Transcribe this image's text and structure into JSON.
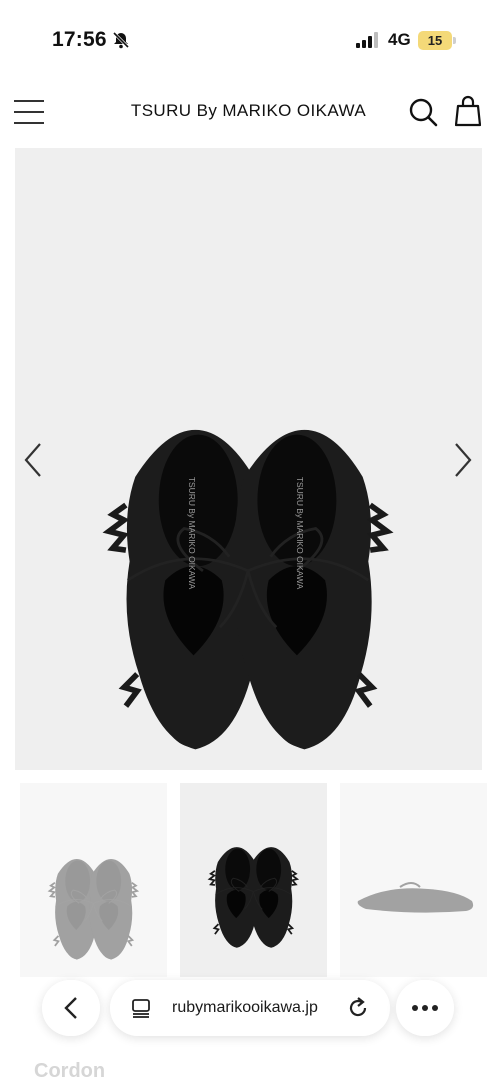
{
  "status_bar": {
    "time": "17:56",
    "network": "4G",
    "battery": "15",
    "icons": [
      "bell-muted-icon",
      "signal-icon"
    ]
  },
  "header": {
    "brand": "TSURU By MARIKO OIKAWA",
    "icons": [
      "menu-icon",
      "search-icon",
      "bag-icon"
    ]
  },
  "gallery": {
    "main_image": "black lace-up ballet shoes with frayed trim, top view",
    "insole_print": "TSURU By MARIKO OIKAWA",
    "thumbnail_count": 3,
    "selected_thumbnail": 2,
    "icons": [
      "chevron-left-icon",
      "chevron-right-icon"
    ]
  },
  "product": {
    "name": "Cordon"
  },
  "browser": {
    "url": "rubymarikooikawa.jp",
    "icons": [
      "back-icon",
      "tabs-icon",
      "reload-icon",
      "more-icon"
    ]
  },
  "colors": {
    "background": "#ffffff",
    "image_bg": "#efefef",
    "battery": "#f4d978",
    "text": "#111111"
  }
}
